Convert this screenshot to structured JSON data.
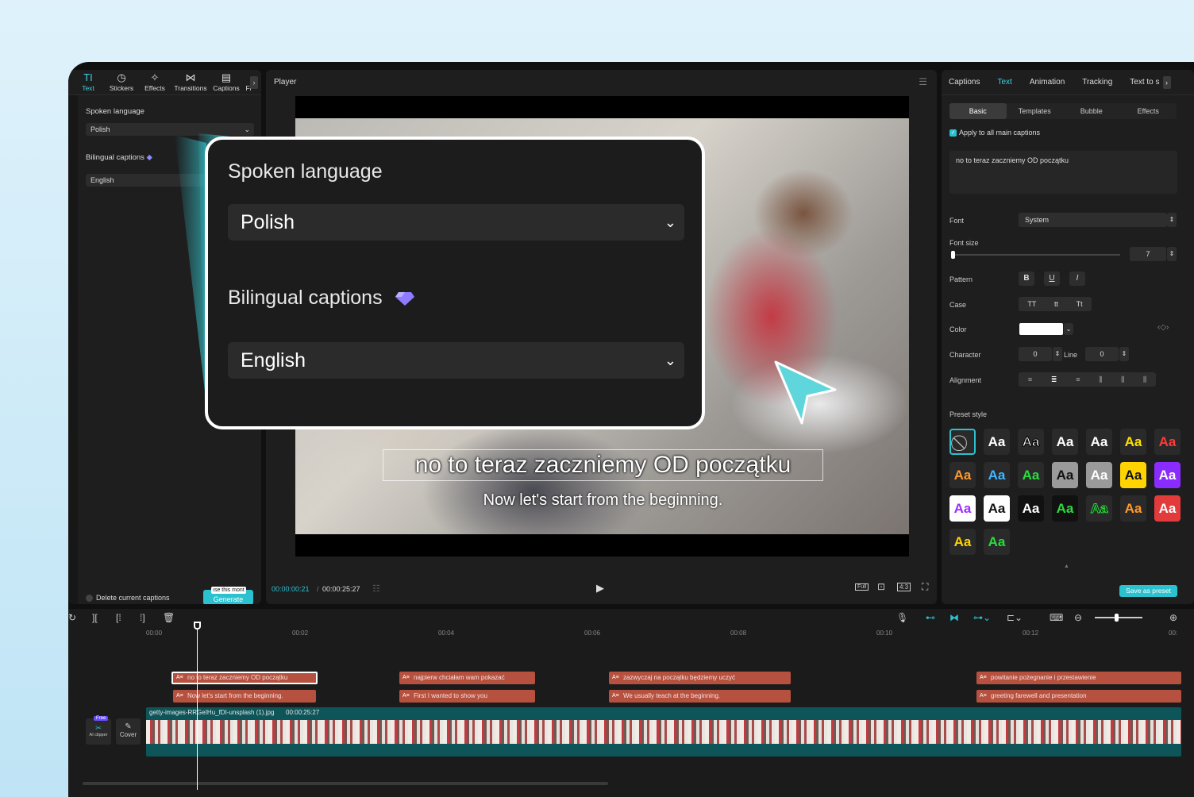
{
  "toolbar": {
    "items": [
      {
        "label": "Text",
        "icon": "text-icon",
        "glyph": "TI"
      },
      {
        "label": "Stickers",
        "icon": "sticker-icon",
        "glyph": "◷"
      },
      {
        "label": "Effects",
        "icon": "effects-icon",
        "glyph": "✧"
      },
      {
        "label": "Transitions",
        "icon": "transition-icon",
        "glyph": "⋈"
      },
      {
        "label": "Captions",
        "icon": "captions-icon",
        "glyph": "▤"
      },
      {
        "label": "Fi",
        "icon": "filter-icon",
        "glyph": ""
      }
    ],
    "more": "›"
  },
  "left": {
    "spoken_label": "Spoken language",
    "spoken_value": "Polish",
    "bilingual_label": "Bilingual captions",
    "bilingual_value": "English",
    "delete_label": "Delete current captions",
    "generate_label": "Generate",
    "generate_tip": "ıse this mont"
  },
  "player": {
    "title": "Player",
    "time_current": "00:00:00:21",
    "time_total": "00:00:25:27",
    "caption_main": "no to teraz zaczniemy OD początku",
    "caption_sub": "Now let's start from the beginning.",
    "full_label": "Full",
    "ratio_label": "4:3"
  },
  "popup": {
    "spoken_label": "Spoken language",
    "spoken_value": "Polish",
    "bilingual_label": "Bilingual captions",
    "bilingual_value": "English"
  },
  "right": {
    "tabs": [
      "Captions",
      "Text",
      "Animation",
      "Tracking",
      "Text to s"
    ],
    "subtabs": [
      "Basic",
      "Templates",
      "Bubble",
      "Effects"
    ],
    "apply_label": "Apply to all main captions",
    "text_value": "no to teraz zaczniemy OD początku",
    "font_label": "Font",
    "font_value": "System",
    "fontsize_label": "Font size",
    "fontsize_value": "7",
    "pattern_label": "Pattern",
    "pattern_b": "B",
    "pattern_u": "U",
    "pattern_i": "I",
    "case_label": "Case",
    "case_options": [
      "TT",
      "tt",
      "Tt"
    ],
    "color_label": "Color",
    "color_value": "#ffffff",
    "character_label": "Character",
    "character_value": "0",
    "line_label": "Line",
    "line_value": "0",
    "alignment_label": "Alignment",
    "preset_label": "Preset style",
    "preset_text": "Aa",
    "save_label": "Save as preset"
  },
  "timeline": {
    "ruler": [
      "00:00",
      "00:02",
      "00:04",
      "00:06",
      "00:08",
      "00:10",
      "00:12",
      "00:"
    ],
    "main_clips": [
      "no to teraz zaczniemy OD początku",
      "najpierw chciałam wam pokazać",
      "zazwyczaj na początku będziemy uczyć",
      "powitanie pożegnanie i przestawienie"
    ],
    "sub_clips": [
      "Now let's start from the beginning.",
      "First I wanted to show you",
      "We usually teach at the beginning.",
      "greeting farewell and presentation"
    ],
    "video_name": "getty-images-RRGeIHu_fDI-unsplash (1).jpg",
    "video_duration": "00:00:25:27",
    "clipper_badge": "Free",
    "clipper_label": "AI clipper",
    "cover_label": "Cover"
  },
  "colors": {
    "accent": "#2bc1cf",
    "caption_clip": "#b6513f",
    "video_track": "#0e5559"
  }
}
